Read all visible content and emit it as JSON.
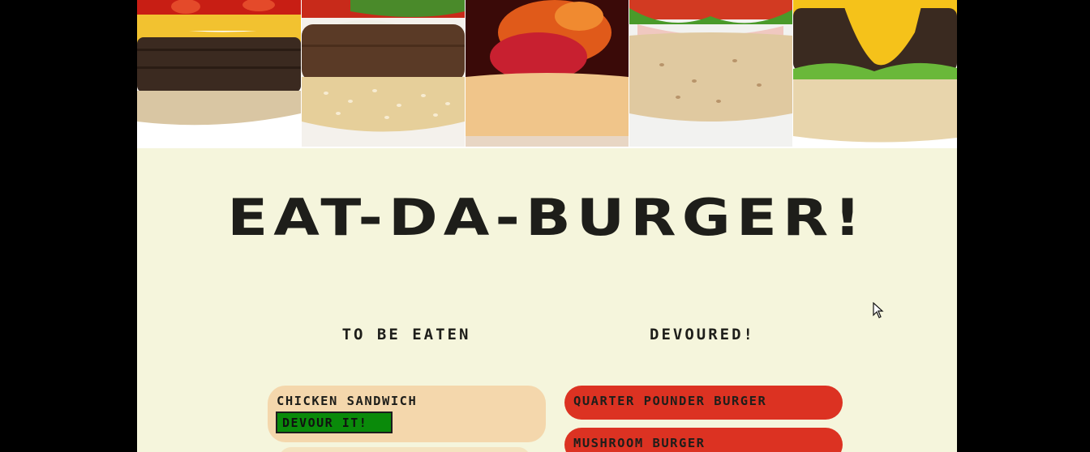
{
  "header": {
    "title": "EAT-DA-BURGER!"
  },
  "hero": {
    "images": [
      {
        "name": "cheeseburger-ketchup-photo",
        "bun": "#d9c6a3",
        "patty": "#3b2a20",
        "top": "#c81e14"
      },
      {
        "name": "sesame-burger-onion-photo",
        "bun": "#e6cf9a",
        "patty": "#5a3a26",
        "top": "#c82a1a"
      },
      {
        "name": "bacon-tomato-burger-photo",
        "bun": "#f0c58a",
        "patty": "#7a1c12",
        "top": "#e05a1a"
      },
      {
        "name": "ham-lettuce-burger-photo",
        "bun": "#e0c9a0",
        "patty": "#f0c8c0",
        "top": "#d23a22"
      },
      {
        "name": "cheese-lettuce-burger-photo",
        "bun": "#e8d5ac",
        "patty": "#3a2a20",
        "top": "#f5c21a"
      }
    ]
  },
  "columns": {
    "to_be_eaten_label": "TO BE EATEN",
    "devoured_label": "DEVOURED!"
  },
  "to_be_eaten": [
    {
      "name": "CHICKEN SANDWICH",
      "button_label": "DEVOUR IT!"
    }
  ],
  "devoured": [
    {
      "name": "QUARTER POUNDER BURGER"
    },
    {
      "name": "MUSHROOM BURGER"
    }
  ],
  "colors": {
    "page_background": "#f5f5dc",
    "outer_background": "#000000",
    "todo_card": "#f4d7ac",
    "devoured_card": "#dc3222",
    "devour_button": "#0a8a0a",
    "text": "#1e1e1a"
  }
}
